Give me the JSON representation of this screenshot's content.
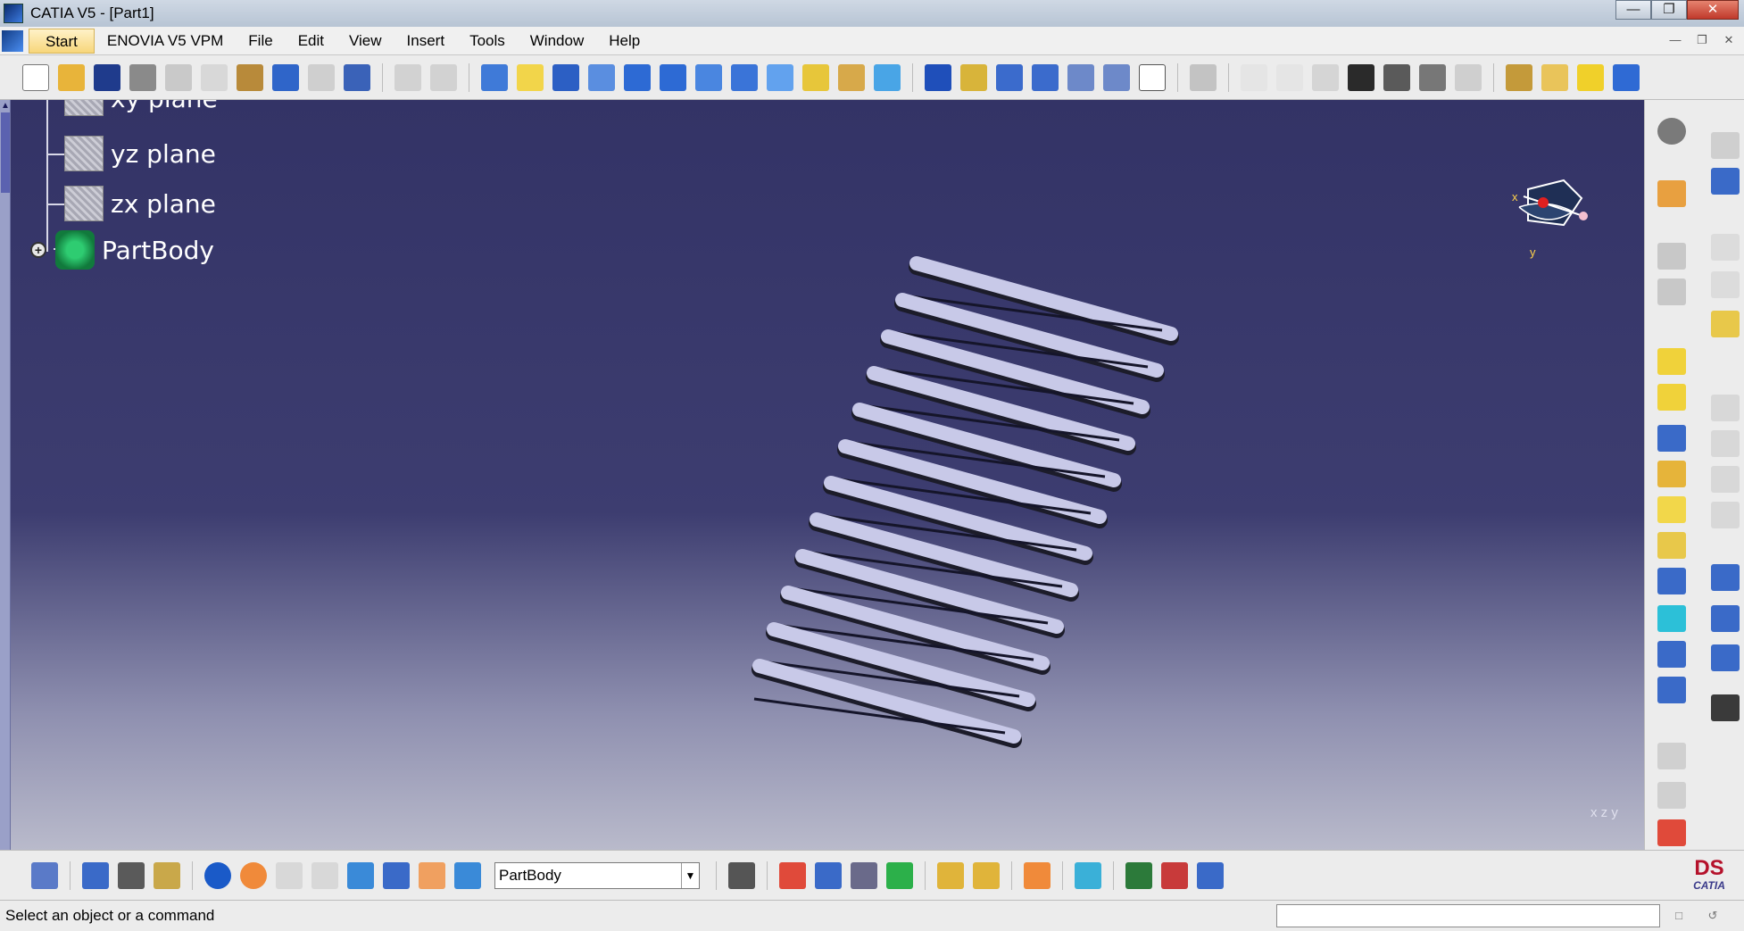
{
  "window": {
    "title": "CATIA V5 - [Part1]"
  },
  "menu": {
    "items": [
      "Start",
      "ENOVIA V5 VPM",
      "File",
      "Edit",
      "View",
      "Insert",
      "Tools",
      "Window",
      "Help"
    ]
  },
  "tree": {
    "nodes": [
      {
        "label": "xy plane",
        "icon": "plane-icon"
      },
      {
        "label": "yz plane",
        "icon": "plane-icon"
      },
      {
        "label": "zx plane",
        "icon": "plane-icon"
      },
      {
        "label": "PartBody",
        "icon": "part-body-icon"
      }
    ]
  },
  "compass": {
    "x": "x",
    "y": "y"
  },
  "axes": {
    "label": "x z y"
  },
  "workbench": {
    "current_body": "PartBody"
  },
  "brand": {
    "ds": "DS",
    "name": "CATIA"
  },
  "status": {
    "message": "Select an object or a command"
  },
  "colors": {
    "viewport_top": "#333366",
    "viewport_bottom": "#b9bacb",
    "spring": "#c8c9e8"
  }
}
